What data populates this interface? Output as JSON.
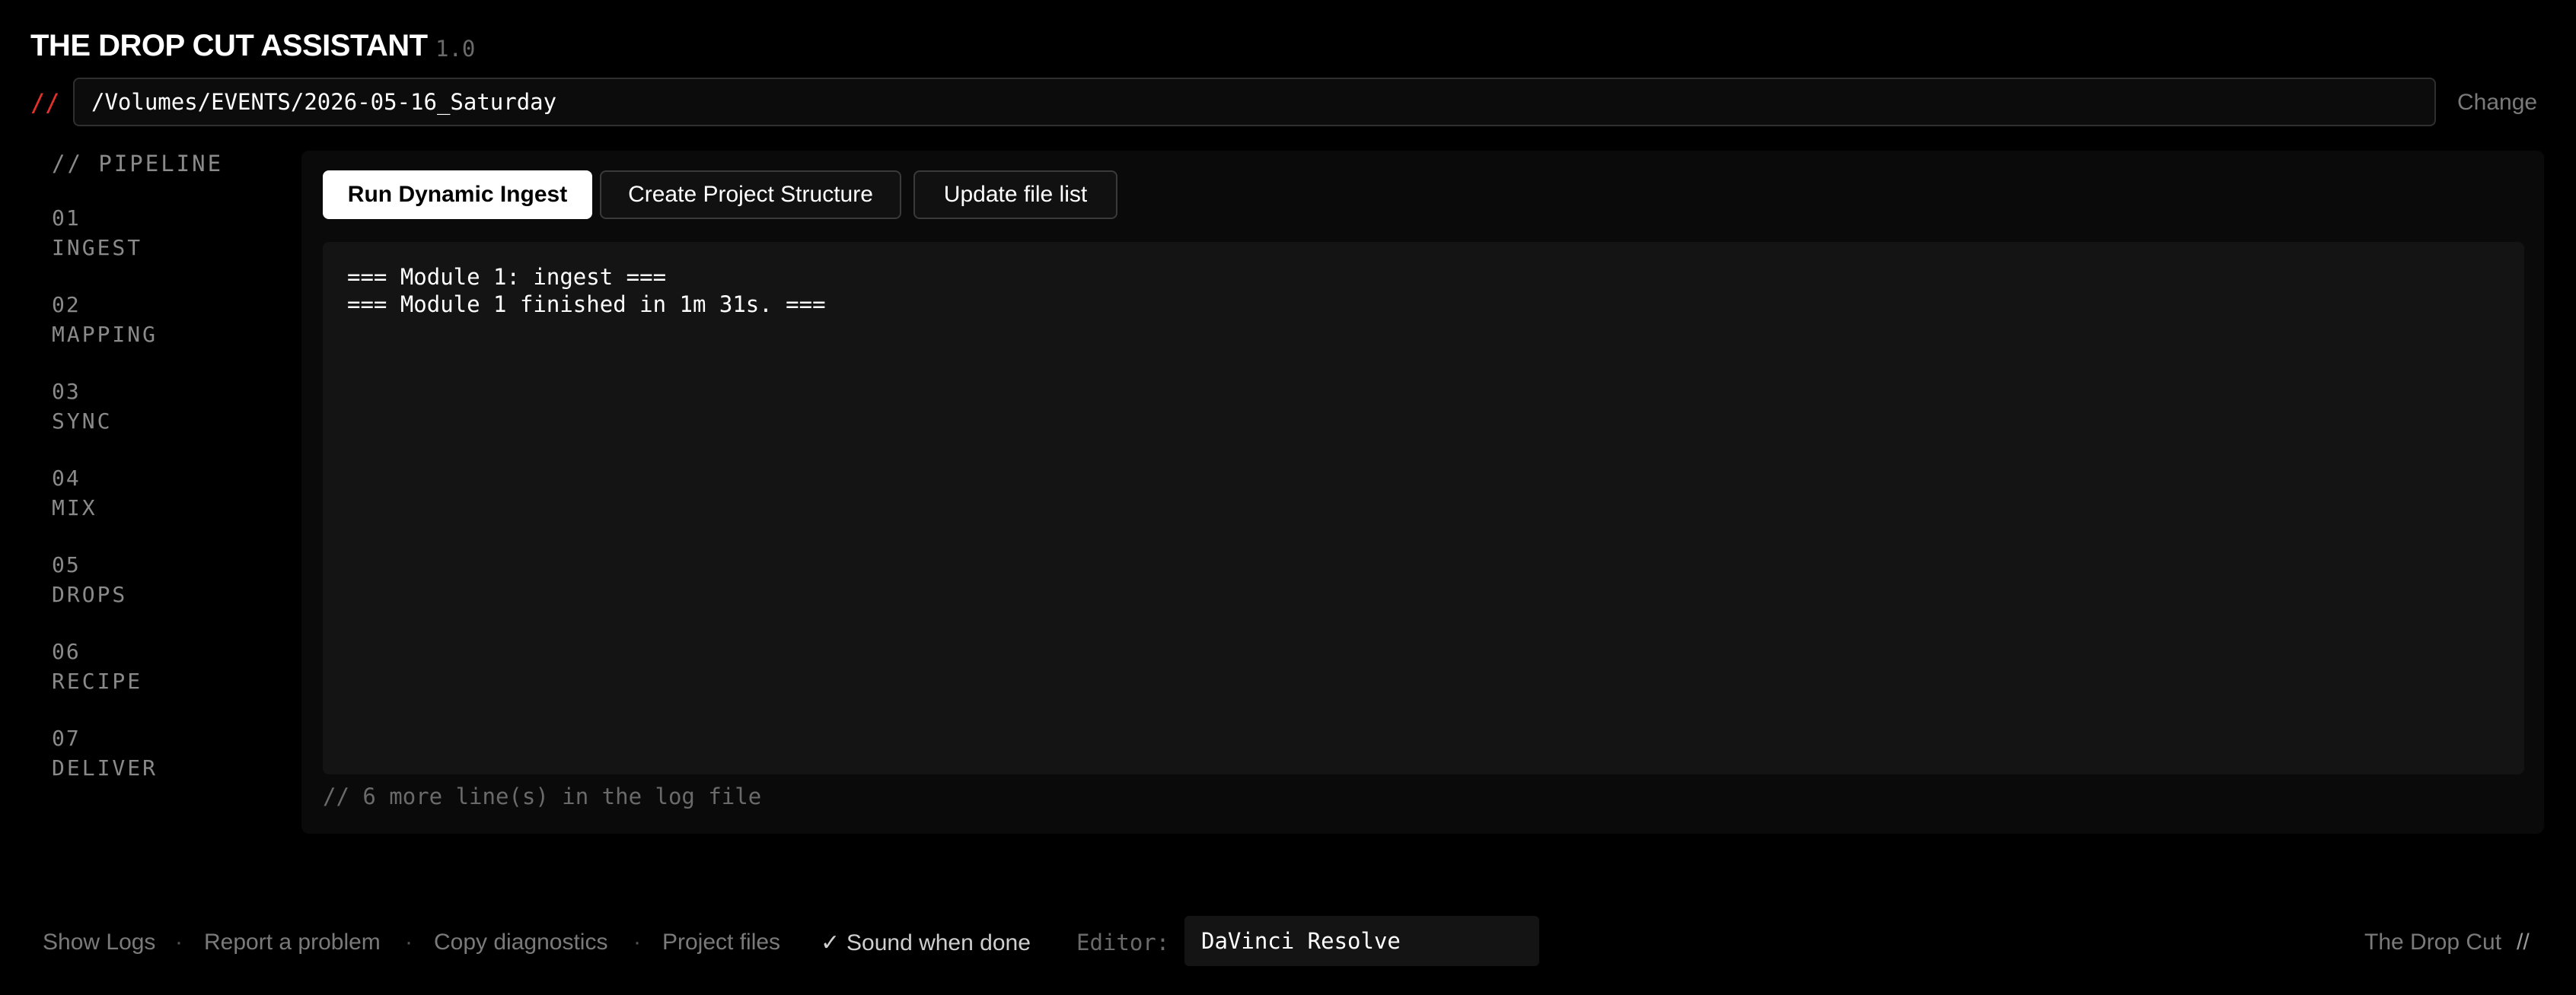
{
  "header": {
    "title": "THE DROP CUT ASSISTANT",
    "version": "1.0"
  },
  "path_bar": {
    "prefix": "//",
    "value": "/Volumes/EVENTS/2026-05-16_Saturday",
    "change_label": "Change"
  },
  "sidebar": {
    "heading": "// PIPELINE",
    "items": [
      {
        "num": "01",
        "label": "INGEST"
      },
      {
        "num": "02",
        "label": "MAPPING"
      },
      {
        "num": "03",
        "label": "SYNC"
      },
      {
        "num": "04",
        "label": "MIX"
      },
      {
        "num": "05",
        "label": "DROPS"
      },
      {
        "num": "06",
        "label": "RECIPE"
      },
      {
        "num": "07",
        "label": "DELIVER"
      }
    ]
  },
  "main": {
    "buttons": {
      "run": "Run Dynamic Ingest",
      "create": "Create Project Structure",
      "update": "Update file list"
    },
    "log": {
      "lines": [
        "=== Module 1: ingest ===",
        "=== Module 1 finished in 1m 31s. ==="
      ],
      "footnote": "// 6 more line(s) in the log file"
    }
  },
  "footer": {
    "links": {
      "show_logs": "Show Logs",
      "report": "Report a problem",
      "copy_diag": "Copy diagnostics",
      "project_files": "Project files"
    },
    "separator": "·",
    "sound": {
      "check": "✓",
      "label": "Sound when done"
    },
    "editor_label": "Editor:",
    "editor_value": "DaVinci Resolve",
    "brand": "The Drop Cut",
    "brand_mark": "//"
  },
  "colors": {
    "background": "#000000",
    "accent": "#e5312c",
    "muted": "#7a7a7a",
    "panel": "#0a0a0a"
  }
}
